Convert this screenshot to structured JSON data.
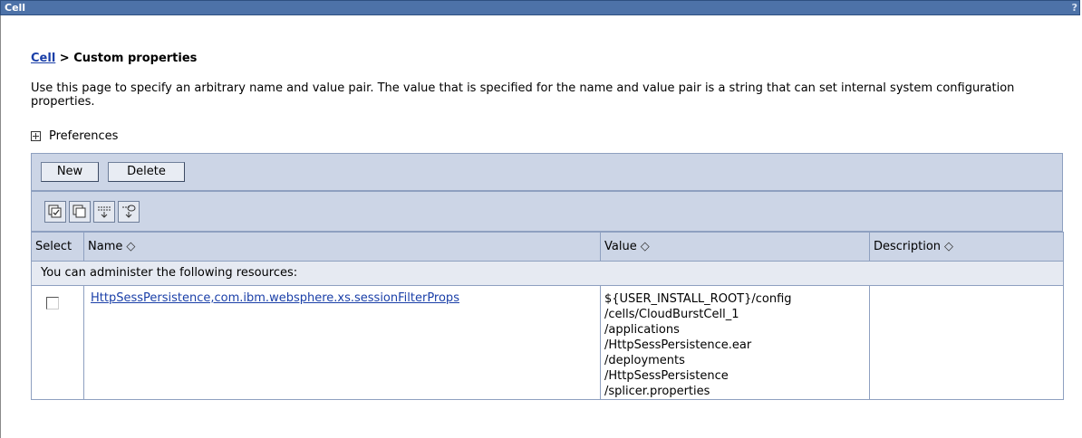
{
  "window": {
    "title": "Cell",
    "help_label": "?"
  },
  "breadcrumb": {
    "link": "Cell",
    "separator": " > ",
    "current": "Custom properties"
  },
  "description": "Use this page to specify an arbitrary name and value pair. The value that is specified for the name and value pair is a string that can set internal system configuration properties.",
  "preferences": {
    "label": "Preferences",
    "icon": "plus-box-icon"
  },
  "toolbar": {
    "new_label": "New",
    "delete_label": "Delete"
  },
  "icon_toolbar": [
    "select-all-icon",
    "deselect-all-icon",
    "show-filter-icon",
    "clear-filter-icon"
  ],
  "table": {
    "columns": [
      "Select",
      "Name",
      "Value",
      "Description"
    ],
    "sort_glyph": "◇",
    "message": "You can administer the following resources:",
    "rows": [
      {
        "selected": false,
        "name": "HttpSessPersistence,com.ibm.websphere.xs.sessionFilterProps",
        "value_lines": [
          "${USER_INSTALL_ROOT}/config",
          "/cells/CloudBurstCell_1",
          "/applications",
          "/HttpSessPersistence.ear",
          "/deployments",
          "/HttpSessPersistence",
          "/splicer.properties"
        ],
        "description": ""
      }
    ]
  },
  "colors": {
    "title_bar": "#4d72a8",
    "panel": "#ccd5e6",
    "link": "#1a3fa8"
  }
}
